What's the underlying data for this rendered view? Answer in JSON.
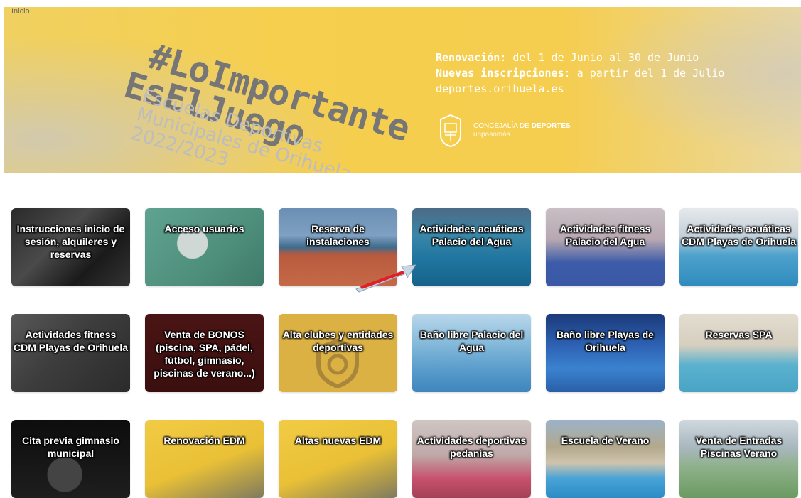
{
  "breadcrumb": "Inicio",
  "banner": {
    "hashtag_line1": "#LoImportante",
    "hashtag_line2": "EsElJuego",
    "subtitle_line1": "Escuelas Deportivas",
    "subtitle_line2": "Municipales de Orihuela",
    "subtitle_line3": "2022/2023",
    "renovacion_label": "Renovación",
    "renovacion_text": ": del 1 de Junio al 30 de Junio",
    "inscripciones_label": "Nuevas inscripciones",
    "inscripciones_text": ": a partir del 1 de Julio",
    "website": "deportes.orihuela.es",
    "concejalia_prefix": "CONCEJALÍA DE ",
    "concejalia_strong": "DEPORTES",
    "concejalia_sub": "unpasomás...",
    "accent_color": "#f5cd4f"
  },
  "tiles": [
    {
      "label": "Instrucciones inicio de sesión, alquileres y reservas",
      "bg": "laptop-photo"
    },
    {
      "label": "Acceso usuarios",
      "bg": "keys-photo"
    },
    {
      "label": "Reserva de instalaciones",
      "bg": "padel-court-photo"
    },
    {
      "label": "Actividades acuáticas Palacio del Agua",
      "bg": "swimming-pool-photo"
    },
    {
      "label": "Actividades fitness Palacio del Agua",
      "bg": "gym-hall-photo"
    },
    {
      "label": "Actividades acuáticas CDM Playas de Orihuela",
      "bg": "indoor-pool-photo"
    },
    {
      "label": "Actividades fitness CDM Playas de Orihuela",
      "bg": "gym-equipment-photo"
    },
    {
      "label": "Venta de BONOS (piscina, SPA, pádel, fútbol, gimnasio, piscinas de verano...)",
      "bg": "dark-red"
    },
    {
      "label": "Alta clubes y entidades deportivas",
      "bg": "shield-yellow"
    },
    {
      "label": "Baño libre Palacio del Agua",
      "bg": "swimmer-photo"
    },
    {
      "label": "Baño libre Playas de Orihuela",
      "bg": "pool-lanes-photo"
    },
    {
      "label": "Reservas SPA",
      "bg": "spa-photo"
    },
    {
      "label": "Cita previa gimnasio municipal",
      "bg": "dumbbell-photo"
    },
    {
      "label": "Renovación EDM",
      "bg": "banner-yellow"
    },
    {
      "label": "Altas nuevas EDM",
      "bg": "banner-yellow"
    },
    {
      "label": "Actividades deportivas pedanías",
      "bg": "yoga-photo"
    },
    {
      "label": "Escuela de Verano",
      "bg": "summer-pool-photo"
    },
    {
      "label": "Venta de Entradas Piscinas Verano",
      "bg": "outdoor-pool-photo"
    }
  ]
}
